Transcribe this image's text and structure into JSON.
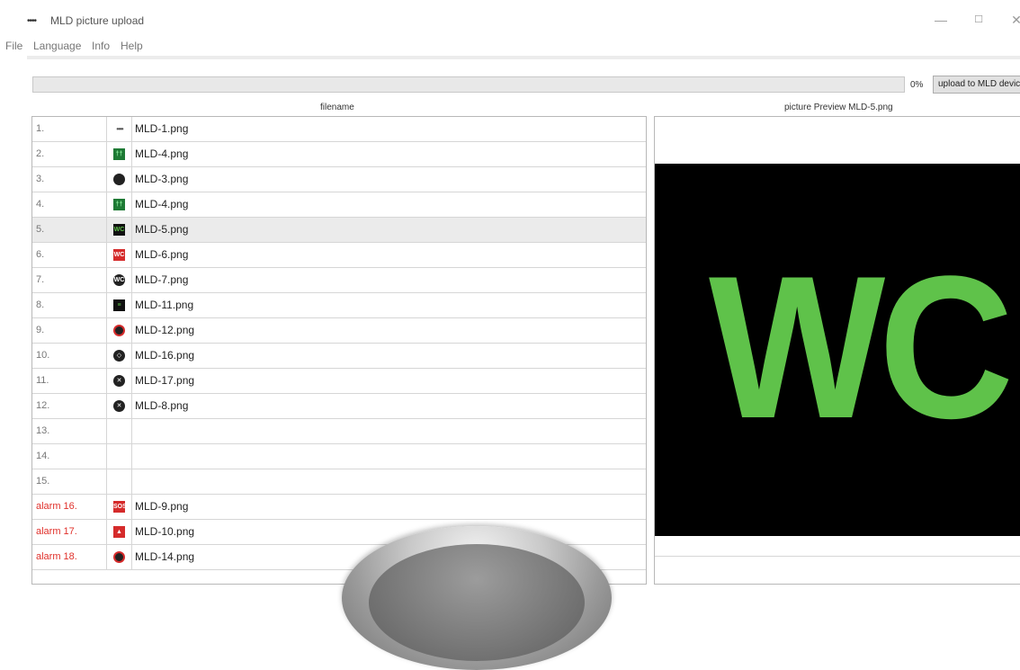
{
  "window": {
    "icon": "••••",
    "title": "MLD picture upload",
    "minimize": "—",
    "maximize": "☐",
    "close": "✕"
  },
  "menu": [
    "File",
    "Language",
    "Info",
    "Help"
  ],
  "toolbar": {
    "progress_percent": 0,
    "progress_label": "0%",
    "upload_button": "upload to MLD device"
  },
  "list_header": "filename",
  "preview_header": "picture Preview MLD-5.png",
  "preview_image_text": "WC",
  "rows": [
    {
      "num": "1.",
      "icon": "dots-icon",
      "icon_text": "••••",
      "file": "MLD-1.png"
    },
    {
      "num": "2.",
      "icon": "people-icon",
      "icon_text": "††",
      "file": "MLD-4.png"
    },
    {
      "num": "3.",
      "icon": "ring-icon",
      "icon_text": "",
      "file": "MLD-3.png"
    },
    {
      "num": "4.",
      "icon": "people-icon",
      "icon_text": "††",
      "file": "MLD-4.png"
    },
    {
      "num": "5.",
      "icon": "wc-icon",
      "icon_text": "WC",
      "file": "MLD-5.png",
      "selected": true
    },
    {
      "num": "6.",
      "icon": "wc-red-icon",
      "icon_text": "WC",
      "file": "MLD-6.png"
    },
    {
      "num": "7.",
      "icon": "wc-circle-icon",
      "icon_text": "WC",
      "file": "MLD-7.png"
    },
    {
      "num": "8.",
      "icon": "bars-icon",
      "icon_text": "≡",
      "file": "MLD-11.png"
    },
    {
      "num": "9.",
      "icon": "red-circle-icon",
      "icon_text": "",
      "file": "MLD-12.png"
    },
    {
      "num": "10.",
      "icon": "arrows-icon",
      "icon_text": "◇",
      "file": "MLD-16.png"
    },
    {
      "num": "11.",
      "icon": "cross-circle-icon",
      "icon_text": "✕",
      "file": "MLD-17.png"
    },
    {
      "num": "12.",
      "icon": "x-circle-icon",
      "icon_text": "✕",
      "file": "MLD-8.png"
    },
    {
      "num": "13.",
      "icon": "",
      "icon_text": "",
      "file": ""
    },
    {
      "num": "14.",
      "icon": "",
      "icon_text": "",
      "file": ""
    },
    {
      "num": "15.",
      "icon": "",
      "icon_text": "",
      "file": ""
    },
    {
      "num": "alarm 16.",
      "icon": "sos-icon",
      "icon_text": "SOS",
      "file": "MLD-9.png",
      "alarm": true
    },
    {
      "num": "alarm 17.",
      "icon": "fire-icon",
      "icon_text": "▲",
      "file": "MLD-10.png",
      "alarm": true
    },
    {
      "num": "alarm 18.",
      "icon": "alarm-circle-icon",
      "icon_text": "",
      "file": "MLD-14.png",
      "alarm": true
    }
  ]
}
